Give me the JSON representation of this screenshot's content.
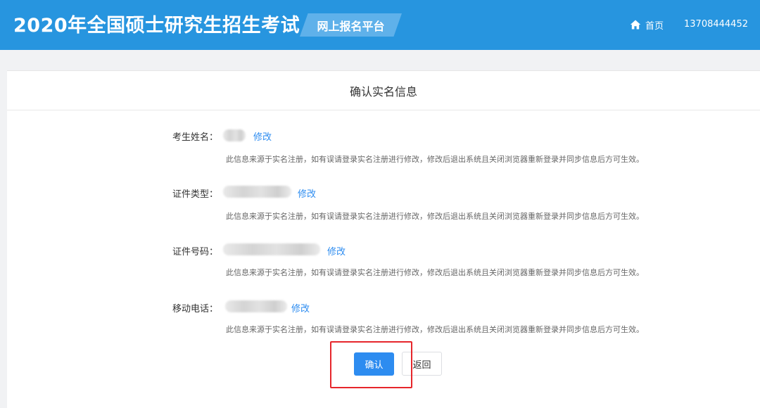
{
  "header": {
    "title": "2020年全国硕士研究生招生考试",
    "platform": "网上报名平台",
    "home_label": "首页",
    "phone": "13708444452",
    "icons": {
      "home": "home-icon"
    }
  },
  "card": {
    "title": "确认实名信息"
  },
  "fields": [
    {
      "label": "考生姓名：",
      "value": "",
      "edit": "修改",
      "hint": "此信息来源于实名注册，如有误请登录实名注册进行修改，修改后退出系统且关闭浏览器重新登录并同步信息后方可生效。"
    },
    {
      "label": "证件类型：",
      "value": "",
      "edit": "修改",
      "hint": "此信息来源于实名注册，如有误请登录实名注册进行修改，修改后退出系统且关闭浏览器重新登录并同步信息后方可生效。"
    },
    {
      "label": "证件号码：",
      "value": "",
      "edit": "修改",
      "hint": "此信息来源于实名注册，如有误请登录实名注册进行修改，修改后退出系统且关闭浏览器重新登录并同步信息后方可生效。"
    },
    {
      "label": "移动电话：",
      "value": "",
      "edit": "修改",
      "hint": "此信息来源于实名注册，如有误请登录实名注册进行修改，修改后退出系统且关闭浏览器重新登录并同步信息后方可生效。"
    }
  ],
  "actions": {
    "confirm_label": "确认",
    "back_label": "返回"
  },
  "colors": {
    "header_bg": "#2795df",
    "primary": "#2d8cf0",
    "highlight": "#e6262b"
  }
}
